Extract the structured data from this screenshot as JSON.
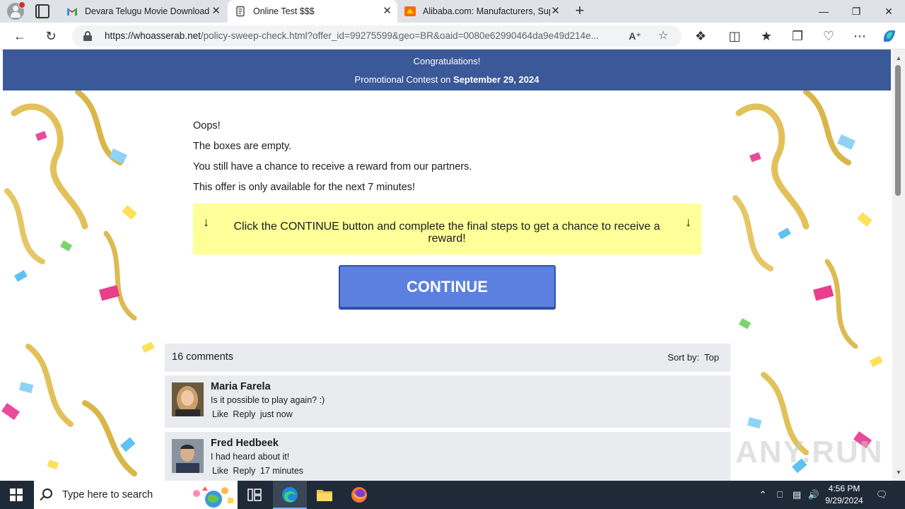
{
  "browser": {
    "tabs": [
      {
        "label": "Devara Telugu Movie Download M",
        "active": false
      },
      {
        "label": "Online Test $$$",
        "active": true
      },
      {
        "label": "Alibaba.com: Manufacturers, Sup",
        "active": false
      }
    ],
    "url_host": "https://whoasserab.net",
    "url_path": "/policy-sweep-check.html?offer_id=99275599&geo=BR&oaid=0080e62990464da9e49d214e..."
  },
  "page": {
    "banner_line1": "Congratulations!",
    "banner_line2_prefix": "Promotional Contest on",
    "banner_date": "September 29, 2024",
    "messages": [
      "Oops!",
      "The boxes are empty.",
      "You still have a chance to receive a reward from our partners.",
      "This offer is only available for the next 7 minutes!"
    ],
    "notice_arrow": "↓",
    "notice_text": "Click the CONTINUE button and complete the final steps to get a chance to receive a reward!",
    "continue_label": "CONTINUE",
    "comments_count": "16 comments",
    "sort_label": "Sort by:",
    "sort_value": "Top",
    "comments": [
      {
        "name": "Maria Farela",
        "text": "Is it possible to play again? :)",
        "like": "Like",
        "reply": "Reply",
        "time": "just now"
      },
      {
        "name": "Fred Hedbeek",
        "text": "I had heard about it!",
        "like": "Like",
        "reply": "Reply",
        "time": "17 minutes"
      }
    ],
    "watermark": "ANY.RUN"
  },
  "taskbar": {
    "search_placeholder": "Type here to search",
    "time": "4:56 PM",
    "date": "9/29/2024"
  },
  "colors": {
    "banner": "#3b5998",
    "notice": "#ffff99",
    "continue_button": "#5b80e0",
    "comment_bg": "#e9ebee"
  }
}
